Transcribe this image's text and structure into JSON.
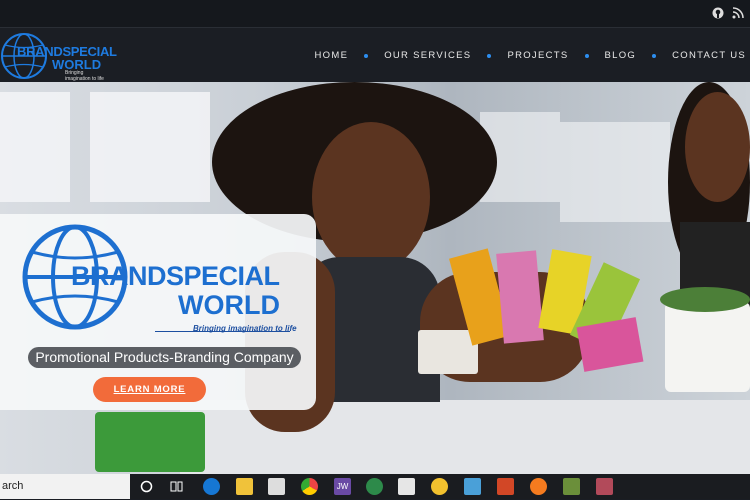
{
  "topbar": {
    "icons": [
      "github-icon",
      "rss-icon"
    ]
  },
  "logo": {
    "line1": "BRANDSPECIAL",
    "line2": "WORLD",
    "tagline": "Bringing imagination to life"
  },
  "nav": {
    "items": [
      "HOME",
      "OUR SERVICES",
      "PROJECTS",
      "BLOG",
      "CONTACT US"
    ]
  },
  "hero": {
    "brand_line1": "BRANDSPECIAL",
    "brand_line2": "WORLD",
    "brand_tagline": "Bringing imagination to life",
    "subtitle": "Promotional Products-Branding Company",
    "cta": "LEARN MORE"
  },
  "taskbar": {
    "search_text": "arch",
    "apps": [
      "cortana-icon",
      "task-view-icon",
      "edge-icon",
      "file-explorer-icon",
      "store-icon",
      "chrome-icon",
      "jw-icon",
      "app-icon",
      "photos-icon",
      "app-icon-2",
      "app-icon-3",
      "powerpoint-icon",
      "firefox-icon",
      "app-icon-4",
      "app-icon-5"
    ]
  },
  "colors": {
    "accent": "#1d6fd0",
    "cta": "#f26b3a",
    "nav_bg": "#1b1e24"
  }
}
